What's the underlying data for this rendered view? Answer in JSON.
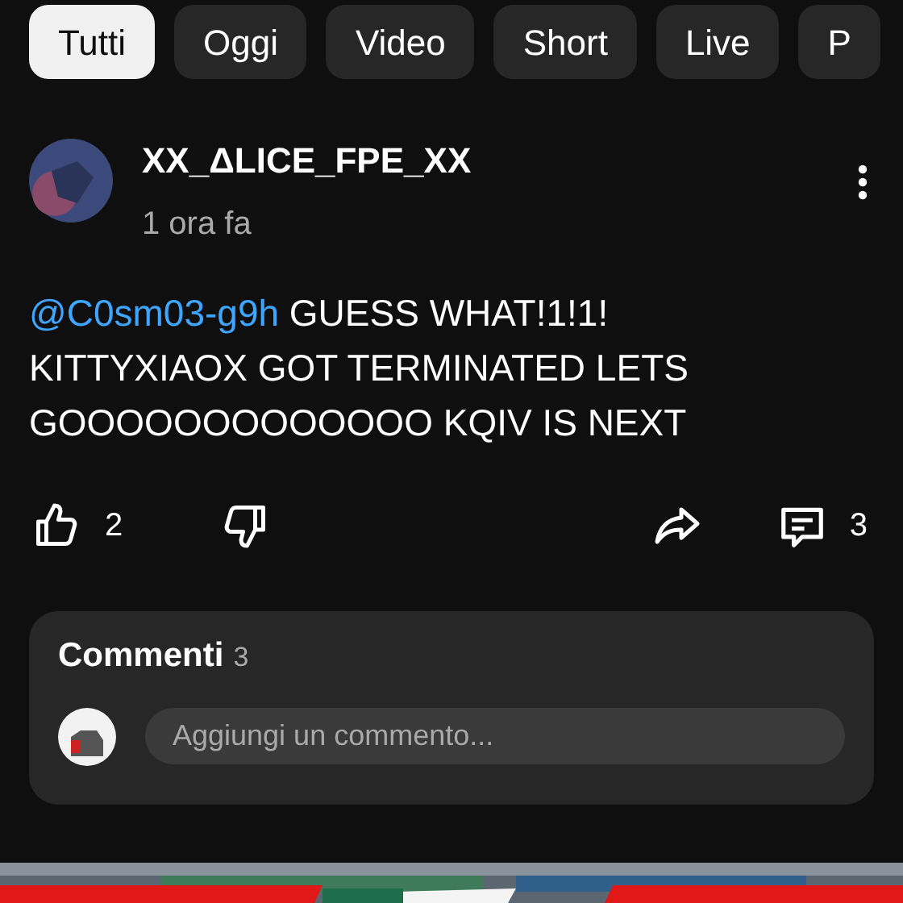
{
  "chips": [
    {
      "label": "Tutti",
      "selected": true
    },
    {
      "label": "Oggi",
      "selected": false
    },
    {
      "label": "Video",
      "selected": false
    },
    {
      "label": "Short",
      "selected": false
    },
    {
      "label": "Live",
      "selected": false
    },
    {
      "label": "P",
      "selected": false
    }
  ],
  "post": {
    "author": "XX_ΔLICE_FPE_XX",
    "time": "1 ora fa",
    "mention": "@C0sm03-g9h",
    "text": "GUESS WHAT!1!1! KITTYXIAOX GOT TERMINATED LETS GOOOOOOOOOOOOO KQIV IS NEXT",
    "likes": "2",
    "comments": "3"
  },
  "comments_panel": {
    "title": "Commenti",
    "count": "3",
    "placeholder": "Aggiungi un commento..."
  }
}
